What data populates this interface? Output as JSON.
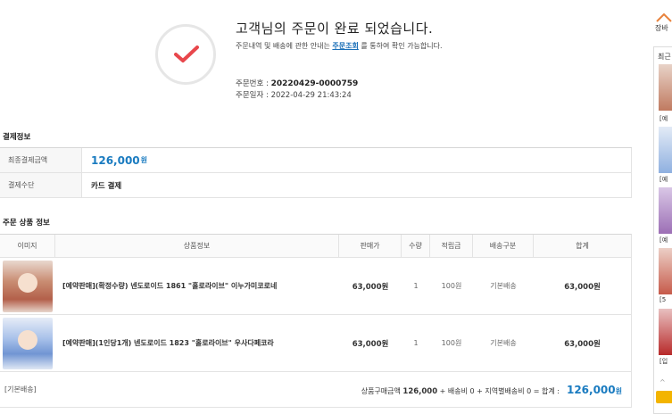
{
  "complete": {
    "title": "고객님의 주문이 완료 되었습니다.",
    "notice_before": "주문내역 및 배송에 관한 안내는 ",
    "notice_link": "주문조회",
    "notice_after": " 를 통하여 확인 가능합니다.",
    "order_no_label": "주문번호 : ",
    "order_no": "20220429-0000759",
    "order_date_label": "주문일자 : ",
    "order_date": "2022-04-29 21:43:24"
  },
  "payment": {
    "section_title": "결제정보",
    "rows": [
      {
        "label": "최종결제금액",
        "value": "126,000",
        "unit": "원"
      },
      {
        "label": "결제수단",
        "value": "카드 결제"
      }
    ]
  },
  "products": {
    "section_title": "주문 상품 정보",
    "headers": [
      "이미지",
      "상품정보",
      "판매가",
      "수량",
      "적립금",
      "배송구분",
      "합계"
    ],
    "rows": [
      {
        "name": "[예약판매](확정수량) 넨도로이드 1861 \"홀로라이브\" 이누가미코로네",
        "price": "63,000원",
        "qty": "1",
        "point": "100원",
        "ship": "기본배송",
        "total": "63,000원"
      },
      {
        "name": "[예약판매](1인당1개) 넨도로이드 1823 \"홀로라이브\" 우사다페코라",
        "price": "63,000원",
        "qty": "1",
        "point": "100원",
        "ship": "기본배송",
        "total": "63,000원"
      }
    ],
    "footer": {
      "ship_type": "[기본배송]",
      "summary_label": "상품구매금액 ",
      "subtotal": "126,000",
      "summary_mid": " + 배송비 0 + 지역별배송비 0 = 합계 :",
      "grand_total": "126,000",
      "grand_unit": "원"
    }
  },
  "sidebar": {
    "cart_label": "장바",
    "recent_label": "최근",
    "items": [
      "[예",
      "[예",
      "[예",
      "[5",
      "[입"
    ],
    "up_arrow": "^"
  },
  "colors": {
    "accent": "#1a7bc0",
    "check": "#e8474c",
    "cart_button": "#f3b400"
  }
}
